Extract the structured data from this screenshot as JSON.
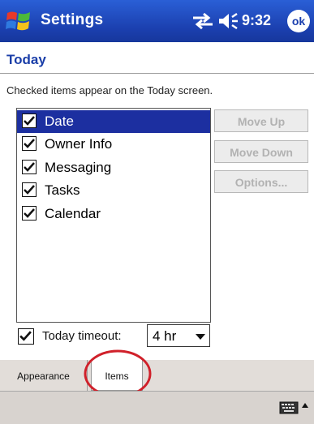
{
  "title_bar": {
    "app_title": "Settings",
    "time": "9:32",
    "ok_label": "ok",
    "icons": [
      "windows-start-icon",
      "connectivity-icon",
      "volume-icon"
    ]
  },
  "page": {
    "title": "Today",
    "instructions": "Checked items appear on the Today screen."
  },
  "items": [
    {
      "label": "Date",
      "checked": true,
      "selected": true
    },
    {
      "label": "Owner Info",
      "checked": true,
      "selected": false
    },
    {
      "label": "Messaging",
      "checked": true,
      "selected": false
    },
    {
      "label": "Tasks",
      "checked": true,
      "selected": false
    },
    {
      "label": "Calendar",
      "checked": true,
      "selected": false
    }
  ],
  "buttons": {
    "move_up": "Move Up",
    "move_down": "Move Down",
    "options": "Options..."
  },
  "timeout": {
    "label": "Today timeout:",
    "checked": true,
    "value": "4 hr"
  },
  "tabs": [
    {
      "label": "Appearance",
      "active": false
    },
    {
      "label": "Items",
      "active": true
    }
  ],
  "colors": {
    "title_bar": "#1b3fae",
    "selection": "#1c2fa0",
    "header_text": "#1a3ea8",
    "highlight_circle": "#d0202a"
  }
}
